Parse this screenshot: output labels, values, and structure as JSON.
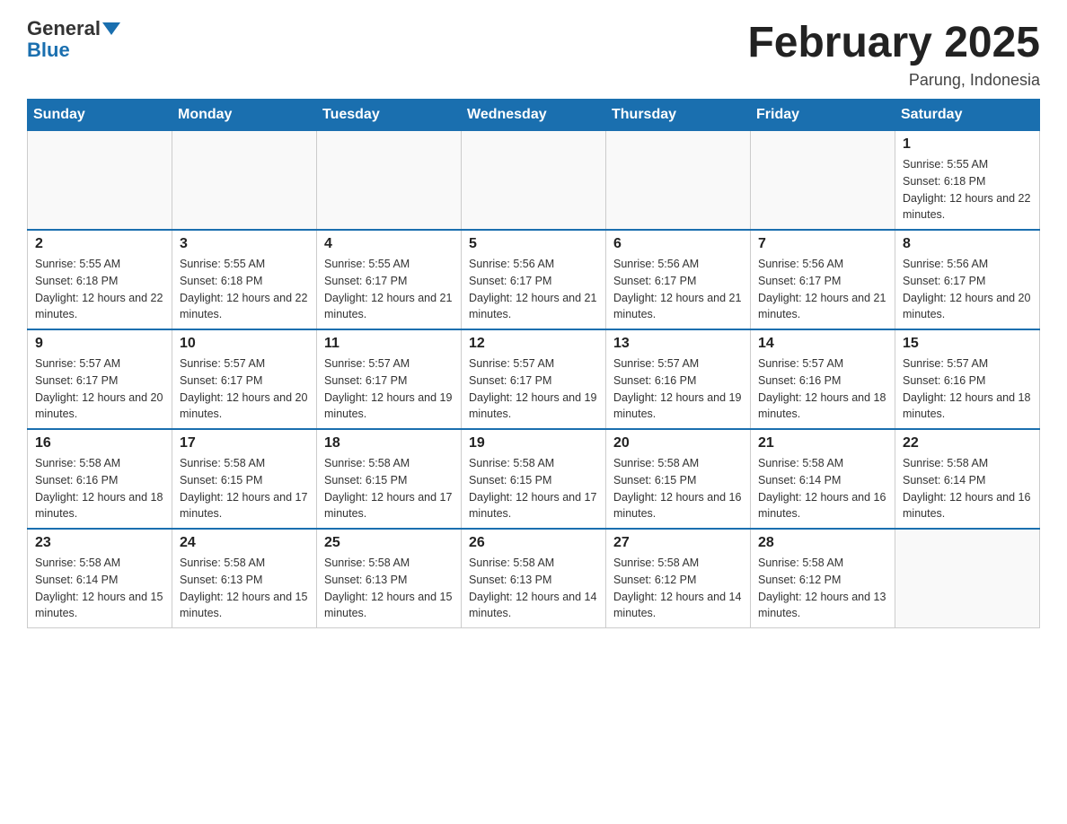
{
  "logo": {
    "general": "General",
    "blue": "Blue"
  },
  "title": "February 2025",
  "location": "Parung, Indonesia",
  "days_header": [
    "Sunday",
    "Monday",
    "Tuesday",
    "Wednesday",
    "Thursday",
    "Friday",
    "Saturday"
  ],
  "weeks": [
    [
      {
        "day": "",
        "info": ""
      },
      {
        "day": "",
        "info": ""
      },
      {
        "day": "",
        "info": ""
      },
      {
        "day": "",
        "info": ""
      },
      {
        "day": "",
        "info": ""
      },
      {
        "day": "",
        "info": ""
      },
      {
        "day": "1",
        "info": "Sunrise: 5:55 AM\nSunset: 6:18 PM\nDaylight: 12 hours and 22 minutes."
      }
    ],
    [
      {
        "day": "2",
        "info": "Sunrise: 5:55 AM\nSunset: 6:18 PM\nDaylight: 12 hours and 22 minutes."
      },
      {
        "day": "3",
        "info": "Sunrise: 5:55 AM\nSunset: 6:18 PM\nDaylight: 12 hours and 22 minutes."
      },
      {
        "day": "4",
        "info": "Sunrise: 5:55 AM\nSunset: 6:17 PM\nDaylight: 12 hours and 21 minutes."
      },
      {
        "day": "5",
        "info": "Sunrise: 5:56 AM\nSunset: 6:17 PM\nDaylight: 12 hours and 21 minutes."
      },
      {
        "day": "6",
        "info": "Sunrise: 5:56 AM\nSunset: 6:17 PM\nDaylight: 12 hours and 21 minutes."
      },
      {
        "day": "7",
        "info": "Sunrise: 5:56 AM\nSunset: 6:17 PM\nDaylight: 12 hours and 21 minutes."
      },
      {
        "day": "8",
        "info": "Sunrise: 5:56 AM\nSunset: 6:17 PM\nDaylight: 12 hours and 20 minutes."
      }
    ],
    [
      {
        "day": "9",
        "info": "Sunrise: 5:57 AM\nSunset: 6:17 PM\nDaylight: 12 hours and 20 minutes."
      },
      {
        "day": "10",
        "info": "Sunrise: 5:57 AM\nSunset: 6:17 PM\nDaylight: 12 hours and 20 minutes."
      },
      {
        "day": "11",
        "info": "Sunrise: 5:57 AM\nSunset: 6:17 PM\nDaylight: 12 hours and 19 minutes."
      },
      {
        "day": "12",
        "info": "Sunrise: 5:57 AM\nSunset: 6:17 PM\nDaylight: 12 hours and 19 minutes."
      },
      {
        "day": "13",
        "info": "Sunrise: 5:57 AM\nSunset: 6:16 PM\nDaylight: 12 hours and 19 minutes."
      },
      {
        "day": "14",
        "info": "Sunrise: 5:57 AM\nSunset: 6:16 PM\nDaylight: 12 hours and 18 minutes."
      },
      {
        "day": "15",
        "info": "Sunrise: 5:57 AM\nSunset: 6:16 PM\nDaylight: 12 hours and 18 minutes."
      }
    ],
    [
      {
        "day": "16",
        "info": "Sunrise: 5:58 AM\nSunset: 6:16 PM\nDaylight: 12 hours and 18 minutes."
      },
      {
        "day": "17",
        "info": "Sunrise: 5:58 AM\nSunset: 6:15 PM\nDaylight: 12 hours and 17 minutes."
      },
      {
        "day": "18",
        "info": "Sunrise: 5:58 AM\nSunset: 6:15 PM\nDaylight: 12 hours and 17 minutes."
      },
      {
        "day": "19",
        "info": "Sunrise: 5:58 AM\nSunset: 6:15 PM\nDaylight: 12 hours and 17 minutes."
      },
      {
        "day": "20",
        "info": "Sunrise: 5:58 AM\nSunset: 6:15 PM\nDaylight: 12 hours and 16 minutes."
      },
      {
        "day": "21",
        "info": "Sunrise: 5:58 AM\nSunset: 6:14 PM\nDaylight: 12 hours and 16 minutes."
      },
      {
        "day": "22",
        "info": "Sunrise: 5:58 AM\nSunset: 6:14 PM\nDaylight: 12 hours and 16 minutes."
      }
    ],
    [
      {
        "day": "23",
        "info": "Sunrise: 5:58 AM\nSunset: 6:14 PM\nDaylight: 12 hours and 15 minutes."
      },
      {
        "day": "24",
        "info": "Sunrise: 5:58 AM\nSunset: 6:13 PM\nDaylight: 12 hours and 15 minutes."
      },
      {
        "day": "25",
        "info": "Sunrise: 5:58 AM\nSunset: 6:13 PM\nDaylight: 12 hours and 15 minutes."
      },
      {
        "day": "26",
        "info": "Sunrise: 5:58 AM\nSunset: 6:13 PM\nDaylight: 12 hours and 14 minutes."
      },
      {
        "day": "27",
        "info": "Sunrise: 5:58 AM\nSunset: 6:12 PM\nDaylight: 12 hours and 14 minutes."
      },
      {
        "day": "28",
        "info": "Sunrise: 5:58 AM\nSunset: 6:12 PM\nDaylight: 12 hours and 13 minutes."
      },
      {
        "day": "",
        "info": ""
      }
    ]
  ]
}
